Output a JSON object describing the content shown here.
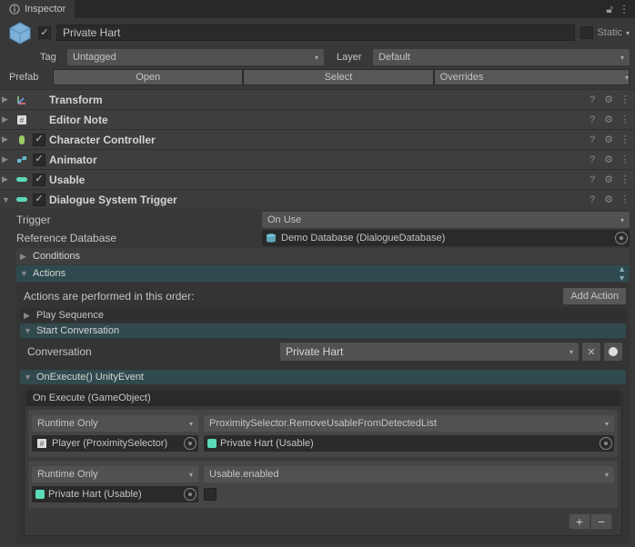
{
  "window": {
    "title": "Inspector",
    "static_label": "Static"
  },
  "object": {
    "name": "Private Hart",
    "enabled": true,
    "tag_label": "Tag",
    "tag_value": "Untagged",
    "layer_label": "Layer",
    "layer_value": "Default"
  },
  "prefab": {
    "label": "Prefab",
    "open": "Open",
    "select": "Select",
    "overrides": "Overrides"
  },
  "components": [
    {
      "name": "Transform",
      "has_checkbox": false,
      "expanded": false,
      "icon": "transform"
    },
    {
      "name": "Editor Note",
      "has_checkbox": false,
      "expanded": false,
      "icon": "script"
    },
    {
      "name": "Character Controller",
      "has_checkbox": true,
      "checked": true,
      "expanded": false,
      "icon": "character"
    },
    {
      "name": "Animator",
      "has_checkbox": true,
      "checked": true,
      "expanded": false,
      "icon": "animator"
    },
    {
      "name": "Usable",
      "has_checkbox": true,
      "checked": true,
      "expanded": false,
      "icon": "usable"
    },
    {
      "name": "Dialogue System Trigger",
      "has_checkbox": true,
      "checked": true,
      "expanded": true,
      "icon": "usable"
    }
  ],
  "dst": {
    "trigger_label": "Trigger",
    "trigger_value": "On Use",
    "refdb_label": "Reference Database",
    "refdb_value": "Demo Database (DialogueDatabase)",
    "conditions_label": "Conditions",
    "actions_label": "Actions",
    "actions_hint": "Actions are performed in this order:",
    "add_action": "Add Action",
    "play_sequence": "Play Sequence",
    "start_conversation": "Start Conversation",
    "conversation_label": "Conversation",
    "conversation_value": "Private Hart",
    "onexecute_header": "OnExecute() UnityEvent",
    "onexecute_title": "On Execute (GameObject)",
    "events": [
      {
        "mode": "Runtime Only",
        "function": "ProximitySelector.RemoveUsableFromDetectedList",
        "target": "Player (ProximitySelector)",
        "target_icon": "script",
        "param": "Private Hart (Usable)",
        "param_type": "object"
      },
      {
        "mode": "Runtime Only",
        "function": "Usable.enabled",
        "target": "Private Hart (Usable)",
        "target_icon": "usable",
        "param_type": "bool",
        "param_bool": false
      }
    ]
  }
}
